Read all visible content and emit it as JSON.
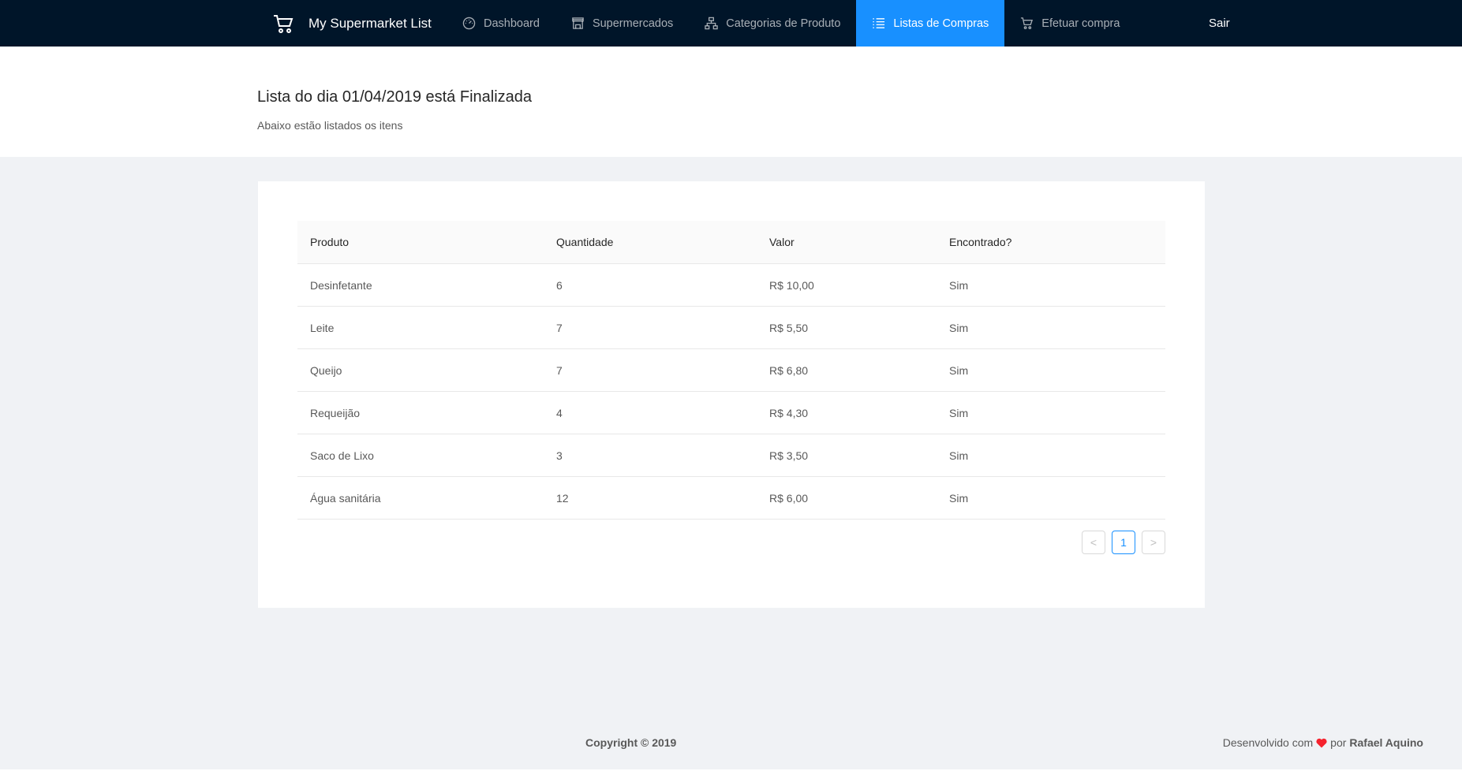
{
  "app": {
    "brand_name": "My Supermarket List"
  },
  "nav": {
    "items": [
      {
        "label": "Dashboard",
        "icon": "dashboard-icon"
      },
      {
        "label": "Supermercados",
        "icon": "shop-icon"
      },
      {
        "label": "Categorias de Produto",
        "icon": "cluster-icon"
      },
      {
        "label": "Listas de Compras",
        "icon": "list-icon",
        "active": true
      },
      {
        "label": "Efetuar compra",
        "icon": "cart-icon"
      }
    ],
    "logout_label": "Sair"
  },
  "header": {
    "title": "Lista do dia 01/04/2019 está Finalizada",
    "subtitle": "Abaixo estão listados os itens"
  },
  "table": {
    "columns": [
      "Produto",
      "Quantidade",
      "Valor",
      "Encontrado?"
    ],
    "rows": [
      [
        "Desinfetante",
        "6",
        "R$ 10,00",
        "Sim"
      ],
      [
        "Leite",
        "7",
        "R$ 5,50",
        "Sim"
      ],
      [
        "Queijo",
        "7",
        "R$ 6,80",
        "Sim"
      ],
      [
        "Requeijão",
        "4",
        "R$ 4,30",
        "Sim"
      ],
      [
        "Saco de Lixo",
        "3",
        "R$ 3,50",
        "Sim"
      ],
      [
        "Água sanitária",
        "12",
        "R$ 6,00",
        "Sim"
      ]
    ]
  },
  "pagination": {
    "prev": "<",
    "current_page": "1",
    "next": ">"
  },
  "footer": {
    "copyright": "Copyright © 2019",
    "credit_prefix": "Desenvolvido com",
    "credit_by": "por",
    "author": "Rafael Aquino"
  },
  "colors": {
    "topbar": "#001529",
    "accent": "#1890ff",
    "heart": "#f5222d",
    "background": "#f0f2f5"
  }
}
